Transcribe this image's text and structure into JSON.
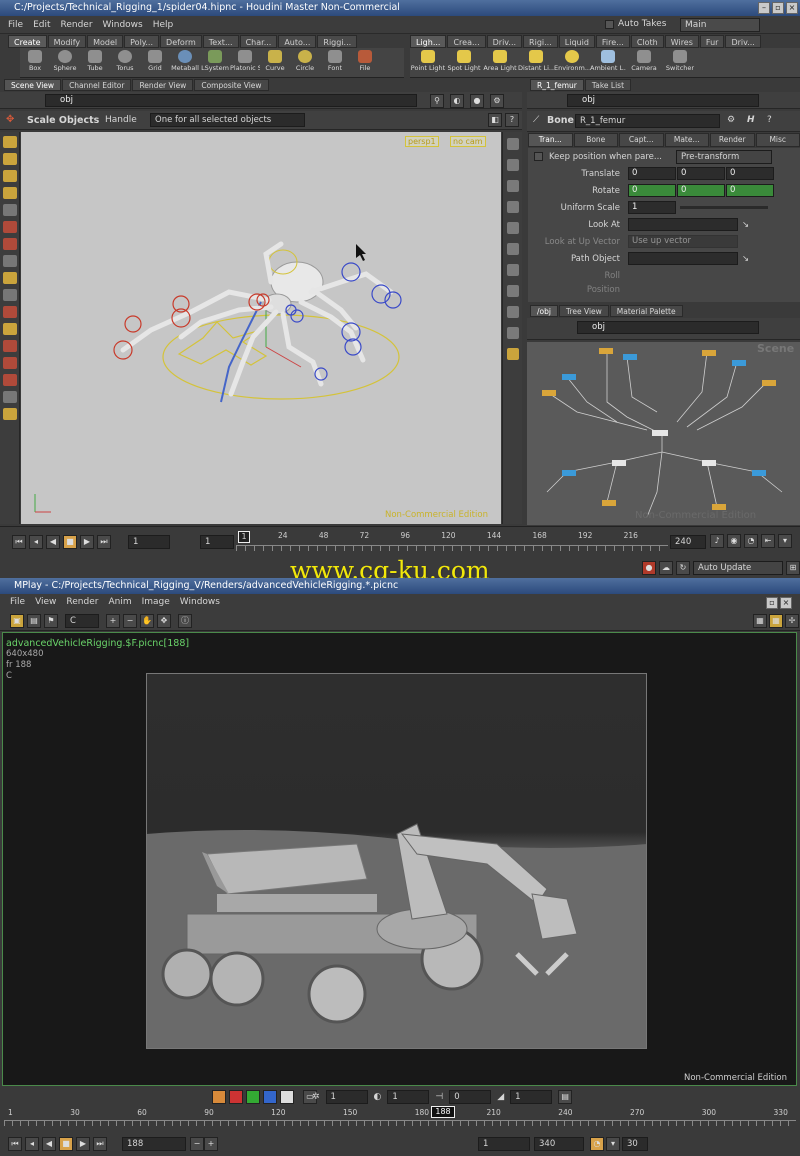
{
  "houdini": {
    "title": "C:/Projects/Technical_Rigging_1/spider04.hipnc - Houdini Master Non-Commercial",
    "menu": [
      "File",
      "Edit",
      "Render",
      "Windows",
      "Help"
    ],
    "auto_takes": "Auto Takes",
    "take": "Main",
    "shelf_tabs_left": [
      "Create",
      "Modify",
      "Model",
      "Poly...",
      "Deform",
      "Text...",
      "Char...",
      "Auto...",
      "Riggi..."
    ],
    "shelf_tabs_right": [
      "Ligh...",
      "Crea...",
      "Driv...",
      "Rigi...",
      "Liquid",
      "Fire...",
      "Cloth",
      "Wires",
      "Fur",
      "Driv..."
    ],
    "tools_left": [
      "Box",
      "Sphere",
      "Tube",
      "Torus",
      "Grid",
      "Metaball",
      "LSystem",
      "Platonic S...",
      "Curve",
      "Circle",
      "Font",
      "File"
    ],
    "tools_right": [
      "Point Light",
      "Spot Light",
      "Area Light",
      "Distant Li...",
      "Environm...",
      "Ambient L...",
      "Camera",
      "Switcher"
    ],
    "left_pane_tabs": [
      "Scene View",
      "Channel Editor",
      "Render View",
      "Composite View"
    ],
    "path": "obj",
    "op_title": "Scale Objects",
    "handle_label": "Handle",
    "handle_mode": "One for all selected objects",
    "persp": "persp1",
    "nocam": "no cam",
    "noncommercial": "Non-Commercial Edition",
    "right_tabs": [
      "R_1_femur",
      "Take List"
    ],
    "node_type": "Bone",
    "node_name": "R_1_femur",
    "param_tabs": [
      "Tran...",
      "Bone",
      "Capt...",
      "Mate...",
      "Render",
      "Misc"
    ],
    "keep_position": "Keep position when pare...",
    "pre_transform": "Pre-transform",
    "params": {
      "translate_label": "Translate",
      "translate": [
        "0",
        "0",
        "0"
      ],
      "rotate_label": "Rotate",
      "rotate": [
        "0",
        "0",
        "0"
      ],
      "uniform_label": "Uniform Scale",
      "uniform": "1",
      "lookat_label": "Look At",
      "lookup_label": "Look at Up Vector",
      "lookup_value": "Use up vector",
      "pathobj_label": "Path Object",
      "roll_label": "Roll",
      "position_label": "Position"
    },
    "net_tabs": [
      "/obj",
      "Tree View",
      "Material Palette"
    ],
    "scene_label": "Scene",
    "frame_start": "1",
    "frame_current": "1",
    "frame_step": "1",
    "frame_end": "240",
    "ticks": [
      "24",
      "48",
      "72",
      "96",
      "120",
      "144",
      "168",
      "192",
      "216"
    ],
    "frame_marker": "1"
  },
  "watermark": "www.cg-ku.com",
  "mplay": {
    "title": "MPlay - C:/Projects/Technical_Rigging_V/Renders/advancedVehicleRigging.*.picnc",
    "auto_update": "Auto Update",
    "menu": [
      "File",
      "View",
      "Render",
      "Anim",
      "Image",
      "Windows"
    ],
    "channel": "C",
    "info": [
      "advancedVehicleRigging.$F.picnc[188]",
      "640x480",
      "fr 188",
      "C"
    ],
    "noncommercial": "Non-Commercial Edition",
    "fields": [
      "1",
      "1",
      "0",
      "1"
    ],
    "ticks": [
      "1",
      "30",
      "60",
      "90",
      "120",
      "150",
      "180",
      "210",
      "240",
      "270",
      "300",
      "330"
    ],
    "current_frame": "188",
    "frame_field": "188",
    "range_start": "1",
    "range_end": "340",
    "fps": "30"
  }
}
